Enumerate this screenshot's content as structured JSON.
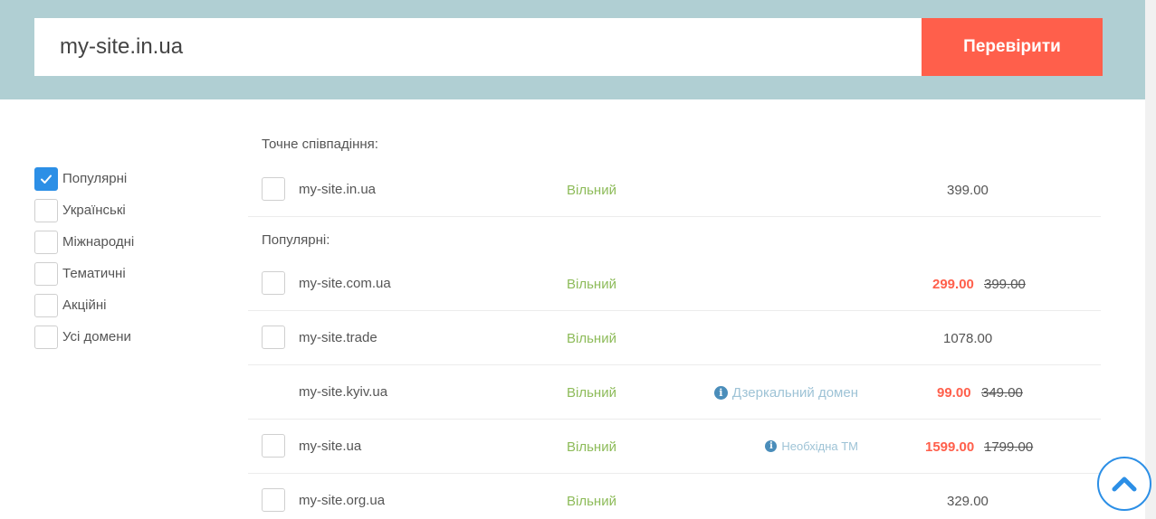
{
  "search": {
    "value": "my-site.in.ua",
    "button_label": "Перевірити"
  },
  "filters": [
    {
      "label": "Популярні",
      "checked": true
    },
    {
      "label": "Українські",
      "checked": false
    },
    {
      "label": "Міжнародні",
      "checked": false
    },
    {
      "label": "Тематичні",
      "checked": false
    },
    {
      "label": "Акційні",
      "checked": false
    },
    {
      "label": "Усі домени",
      "checked": false
    }
  ],
  "exact": {
    "title": "Точне співпадіння:",
    "row": {
      "domain": "my-site.in.ua",
      "status": "Вільний",
      "price": "399.00"
    }
  },
  "popular": {
    "title": "Популярні:",
    "rows": [
      {
        "domain": "my-site.com.ua",
        "status": "Вільний",
        "price_sale": "299.00",
        "price_old": "399.00"
      },
      {
        "domain": "my-site.trade",
        "status": "Вільний",
        "price": "1078.00"
      },
      {
        "domain": "my-site.kyiv.ua",
        "status": "Вільний",
        "note": "Дзеркальний домен",
        "price_sale": "99.00",
        "price_old": "349.00"
      },
      {
        "domain": "my-site.ua",
        "status": "Вільний",
        "note": "Необхідна ТМ",
        "price_sale": "1599.00",
        "price_old": "1799.00"
      },
      {
        "domain": "my-site.org.ua",
        "status": "Вільний",
        "price": "329.00"
      }
    ]
  },
  "colors": {
    "accent_blue": "#2c8fe6",
    "sale_red": "#ff5f4b",
    "status_green": "#8dbb59",
    "header_bg": "#b0cfd3"
  }
}
